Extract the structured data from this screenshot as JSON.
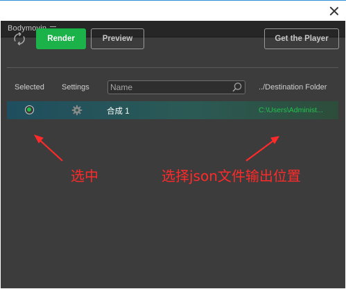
{
  "panel": {
    "title": "Bodymovin",
    "menu_icon": "hamburger-menu-icon"
  },
  "toolbar": {
    "refresh_icon": "refresh-icon",
    "render_label": "Render",
    "preview_label": "Preview",
    "get_player_label": "Get the Player"
  },
  "columns": {
    "selected": "Selected",
    "settings": "Settings",
    "destination": "../Destination Folder"
  },
  "search": {
    "placeholder": "Name",
    "value": ""
  },
  "compositions": [
    {
      "selected": true,
      "name": "合成 1",
      "destination": "C:\\Users\\Administ..."
    }
  ],
  "annotations": {
    "selected_note": "选中",
    "json_note": "选择json文件输出位置"
  },
  "colors": {
    "accent_green": "#1bb24a",
    "panel_bg": "#3c3c3c",
    "annotation_red": "#ff2a2a",
    "destination_text": "#25c24f"
  }
}
